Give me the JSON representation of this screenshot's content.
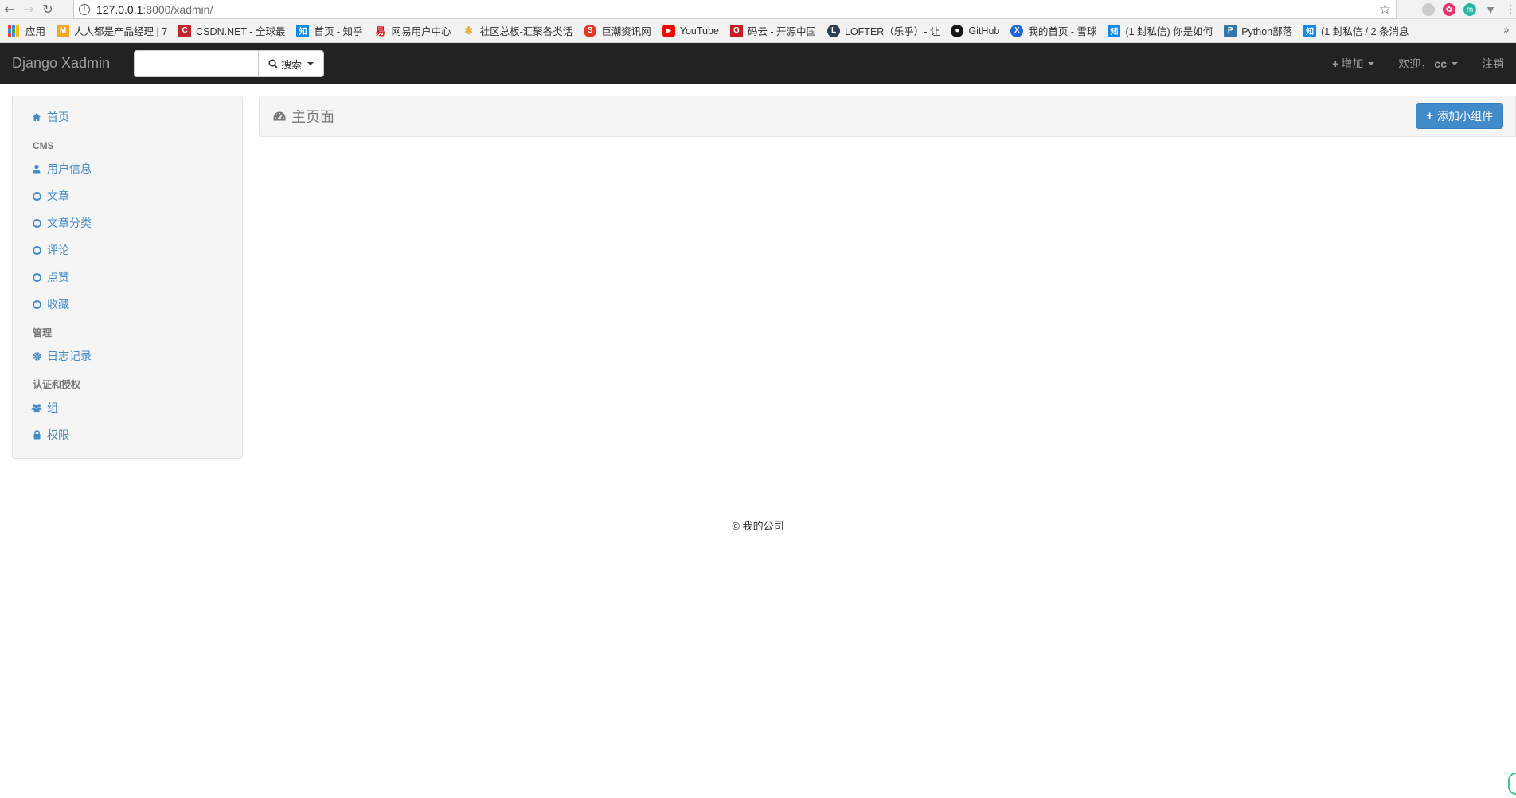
{
  "browser": {
    "url_host": "127.0.0.1",
    "url_path": ":8000/xadmin/",
    "bookmarks": [
      {
        "label": "应用",
        "icon": "apps-grid-icon"
      },
      {
        "label": "人人都是产品经理 | 7",
        "icon": "woshipm-icon",
        "color": "#f5a623"
      },
      {
        "label": "CSDN.NET - 全球最",
        "icon": "csdn-icon",
        "color": "#c7232a"
      },
      {
        "label": "首页 - 知乎",
        "icon": "zhihu-icon",
        "color": "#0f88eb"
      },
      {
        "label": "网易用户中心",
        "icon": "netease-icon",
        "color": "#d0141c"
      },
      {
        "label": "社区总板-汇聚各类话",
        "icon": "community-icon",
        "color": "#e8b43c"
      },
      {
        "label": "巨潮资讯网",
        "icon": "cninfo-icon",
        "color": "#e03a2a"
      },
      {
        "label": "YouTube",
        "icon": "youtube-icon",
        "color": "#ff0000"
      },
      {
        "label": "码云 - 开源中国",
        "icon": "gitee-icon",
        "color": "#c71d23"
      },
      {
        "label": "LOFTER（乐乎）- 让",
        "icon": "lofter-icon",
        "color": "#2c3e50"
      },
      {
        "label": "GitHub",
        "icon": "github-icon",
        "color": "#181717"
      },
      {
        "label": "我的首页 - 雪球",
        "icon": "xueqiu-icon",
        "color": "#1f67d8"
      },
      {
        "label": "(1 封私信) 你是如何",
        "icon": "zhihu-icon",
        "color": "#0f88eb"
      },
      {
        "label": "Python部落",
        "icon": "python-icon",
        "color": "#3776ab"
      },
      {
        "label": "(1 封私信 / 2 条消息",
        "icon": "zhihu-icon",
        "color": "#0f88eb"
      }
    ]
  },
  "navbar": {
    "brand": "Django Xadmin",
    "search_placeholder": "",
    "search_button": "搜索",
    "add_label": "增加",
    "welcome_label": "欢迎，",
    "username": "cc",
    "logout_label": "注销"
  },
  "sidebar": {
    "home": "首页",
    "sections": [
      {
        "header": "CMS",
        "items": [
          {
            "label": "用户信息",
            "icon": "user-icon"
          },
          {
            "label": "文章",
            "icon": "circle-icon"
          },
          {
            "label": "文章分类",
            "icon": "circle-icon"
          },
          {
            "label": "评论",
            "icon": "circle-icon"
          },
          {
            "label": "点赞",
            "icon": "circle-icon"
          },
          {
            "label": "收藏",
            "icon": "circle-icon"
          }
        ]
      },
      {
        "header": "管理",
        "items": [
          {
            "label": "日志记录",
            "icon": "cog-icon"
          }
        ]
      },
      {
        "header": "认证和授权",
        "items": [
          {
            "label": "组",
            "icon": "group-icon"
          },
          {
            "label": "权限",
            "icon": "lock-icon"
          }
        ]
      }
    ]
  },
  "main": {
    "title": "主页面",
    "add_widget_button": "添加小组件"
  },
  "footer": {
    "text": "© 我的公司"
  },
  "colors": {
    "navbar_bg": "#222222",
    "link": "#428bca",
    "primary_button": "#428bca"
  }
}
